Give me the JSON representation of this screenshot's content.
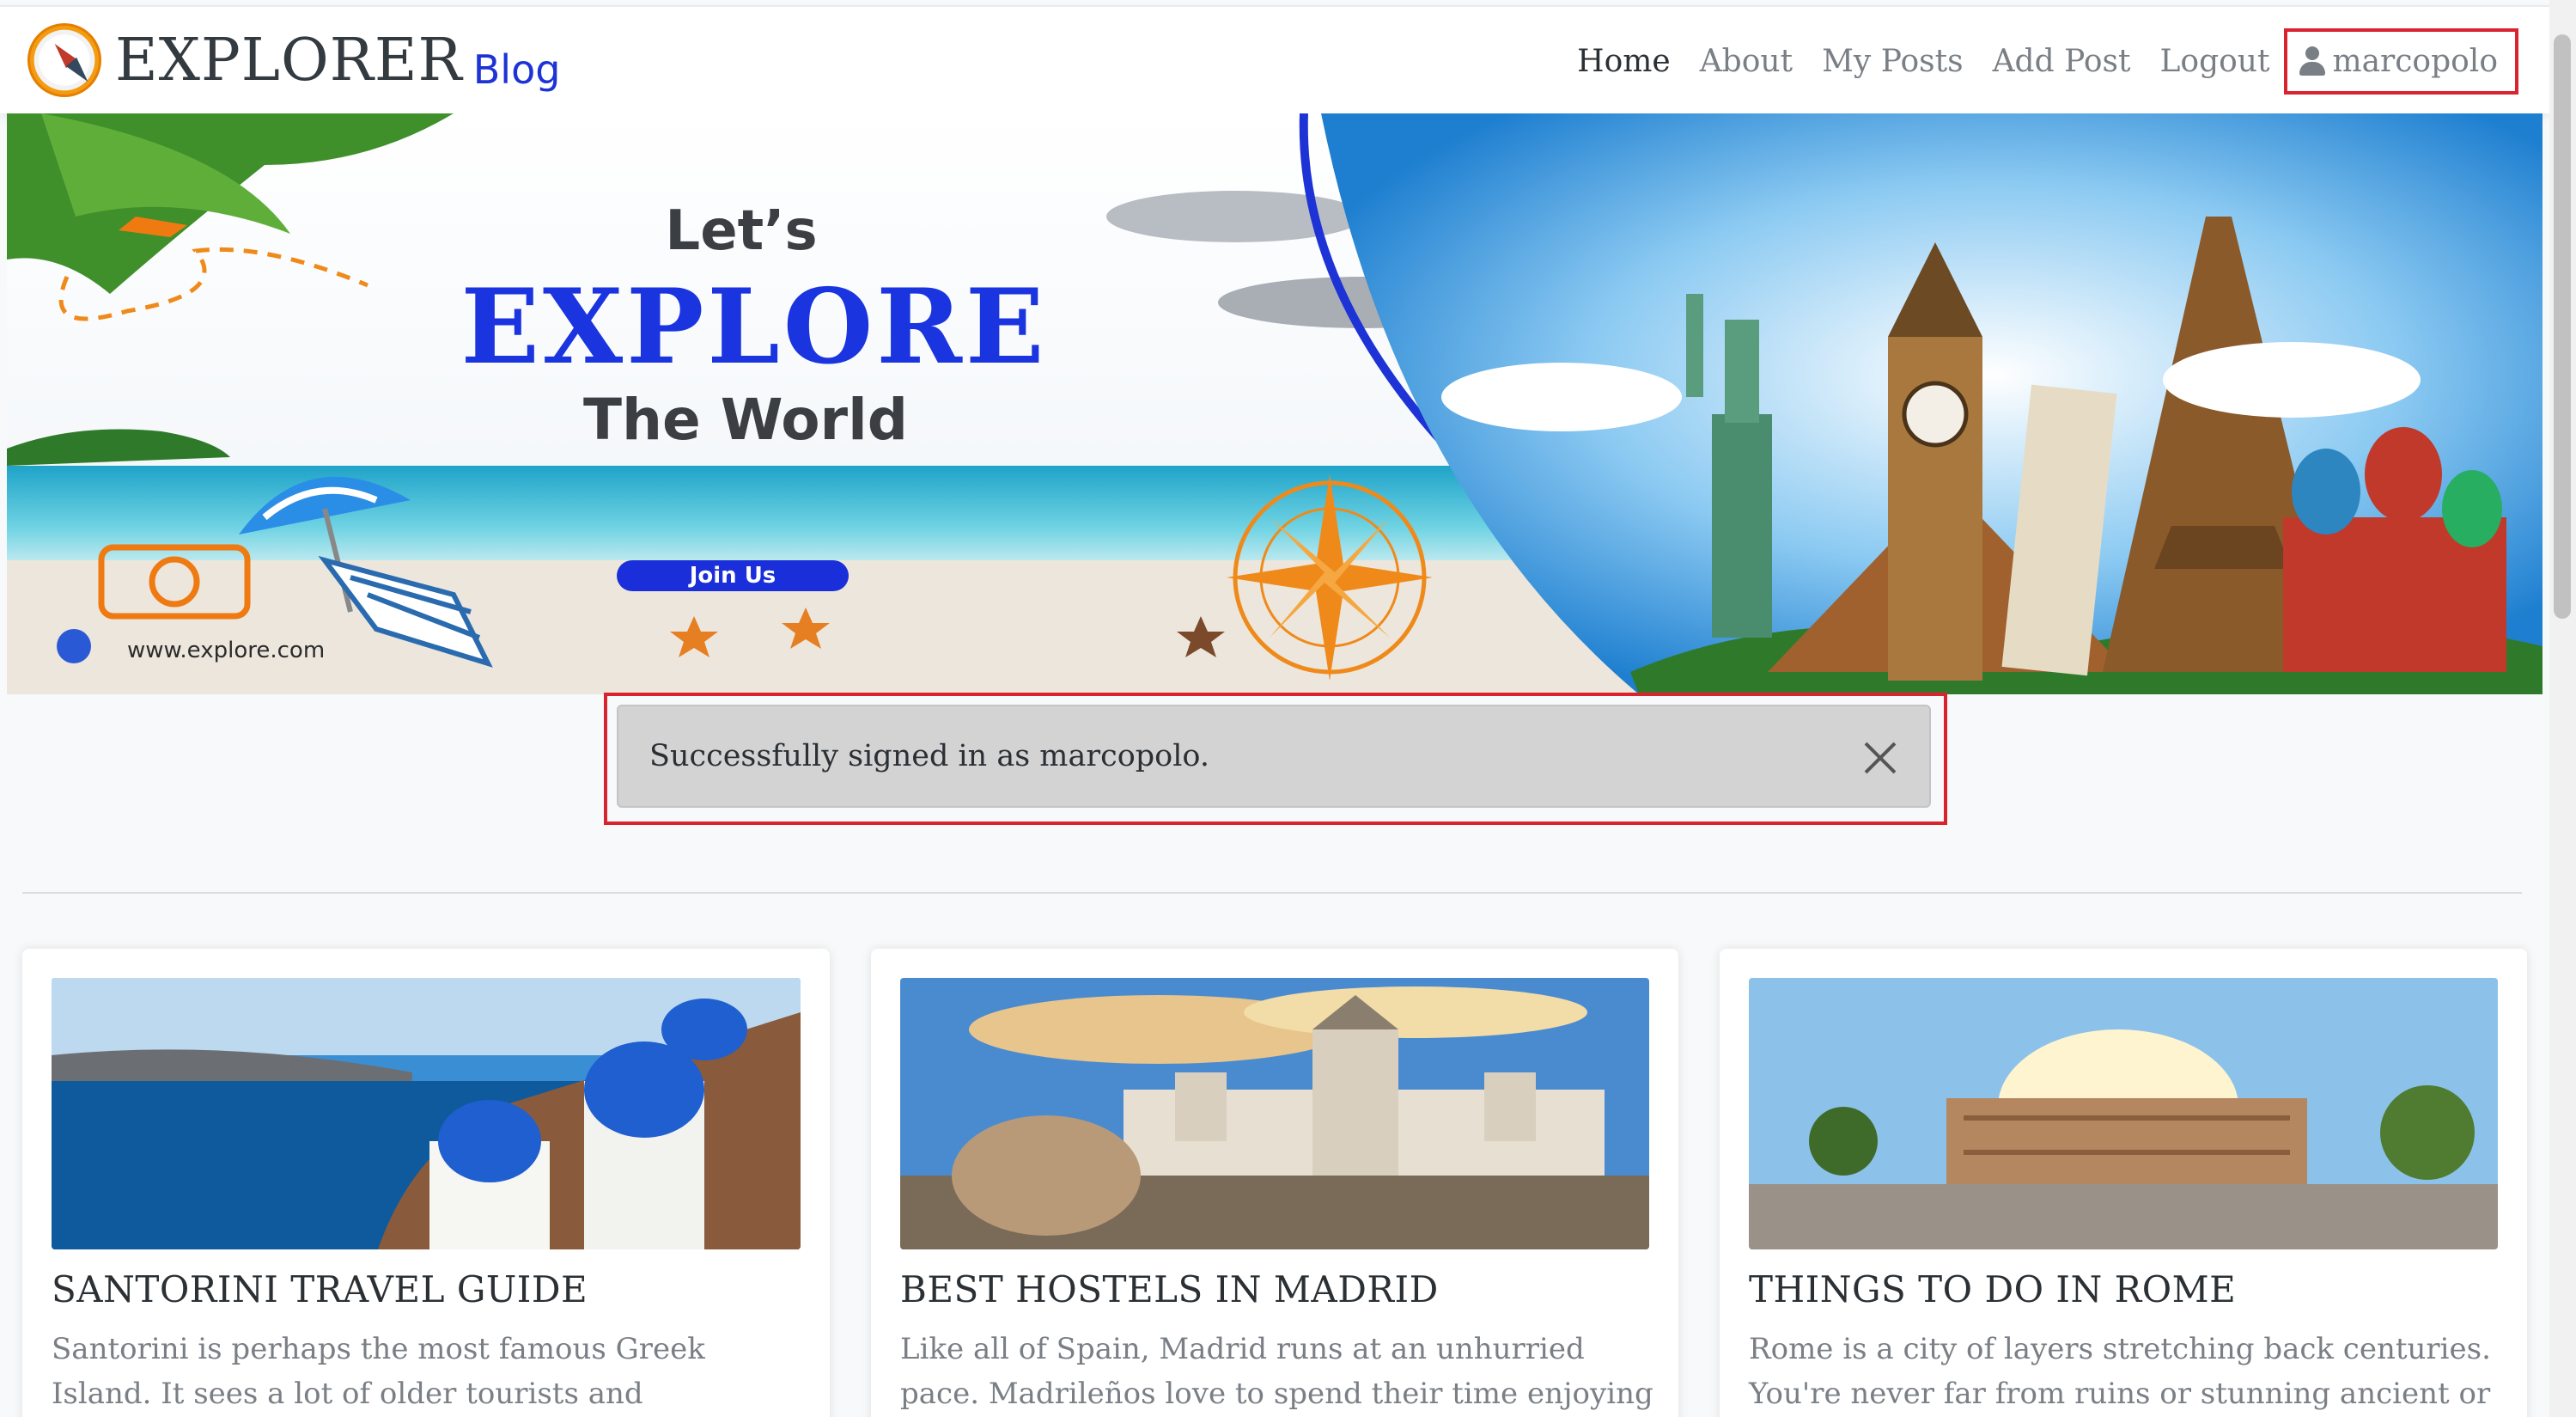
{
  "brand": {
    "name": "EXPLORER",
    "sub": "Blog",
    "logo_icon": "compass-icon"
  },
  "nav": {
    "links": [
      "Home",
      "About",
      "My Posts",
      "Add Post",
      "Logout"
    ],
    "active": "Home",
    "user_icon": "user-icon",
    "username": "marcopolo"
  },
  "hero": {
    "line1": "Let’s",
    "line2": "EXPLORE",
    "line3": "The World",
    "button": "Join Us",
    "url": "www.explore.com"
  },
  "alert": {
    "message": "Successfully signed in as marcopolo.",
    "close_icon": "close-icon"
  },
  "posts": [
    {
      "title": "SANTORINI TRAVEL GUIDE",
      "excerpt": "Santorini is perhaps the most famous Greek Island. It sees a lot of older tourists and honeymooners (it"
    },
    {
      "title": "BEST HOSTELS IN MADRID",
      "excerpt": "Like all of Spain, Madrid runs at an unhurried pace. Madrileños love to spend their time enjoying long"
    },
    {
      "title": "THINGS TO DO IN ROME",
      "excerpt": "Rome is a city of layers stretching back centuries. You're never far from ruins or stunning ancient or"
    }
  ],
  "colors": {
    "accent_blue": "#1a34e0",
    "highlight_red": "#d9232e",
    "alert_bg": "#d3d3d3"
  }
}
